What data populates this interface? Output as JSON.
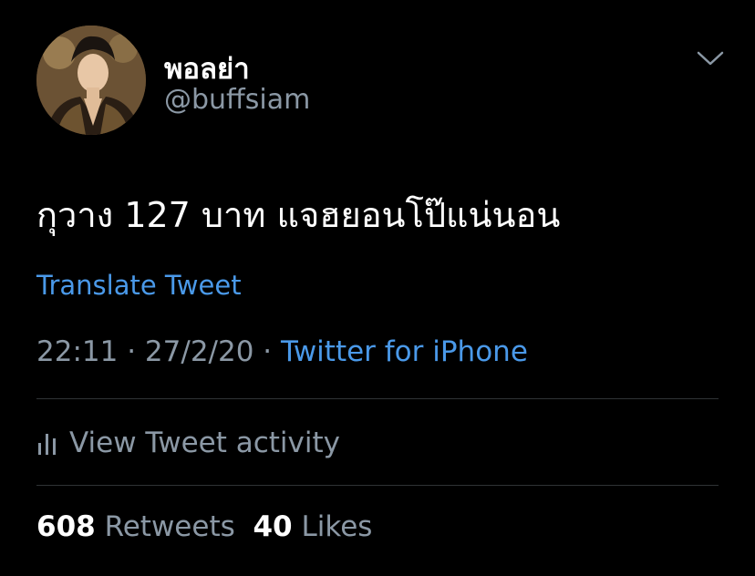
{
  "author": {
    "display_name": "พอลย่า",
    "handle": "@buffsiam"
  },
  "tweet": {
    "text": "กุวาง 127 บาท แจฮยอนโป๊แน่นอน",
    "translate_label": "Translate Tweet",
    "time": "22:11",
    "date": "27/2/20",
    "separator": "·",
    "source": "Twitter for iPhone"
  },
  "activity": {
    "label": "View Tweet activity"
  },
  "stats": {
    "retweets_count": "608",
    "retweets_label": "Retweets",
    "likes_count": "40",
    "likes_label": "Likes"
  },
  "icons": {
    "more": "chevron-down-icon",
    "activity": "bar-chart-icon"
  },
  "colors": {
    "background": "#000000",
    "link": "#4a99e9",
    "secondary_text": "#8b98a5",
    "primary_text": "#ffffff",
    "divider": "#2f3336"
  }
}
